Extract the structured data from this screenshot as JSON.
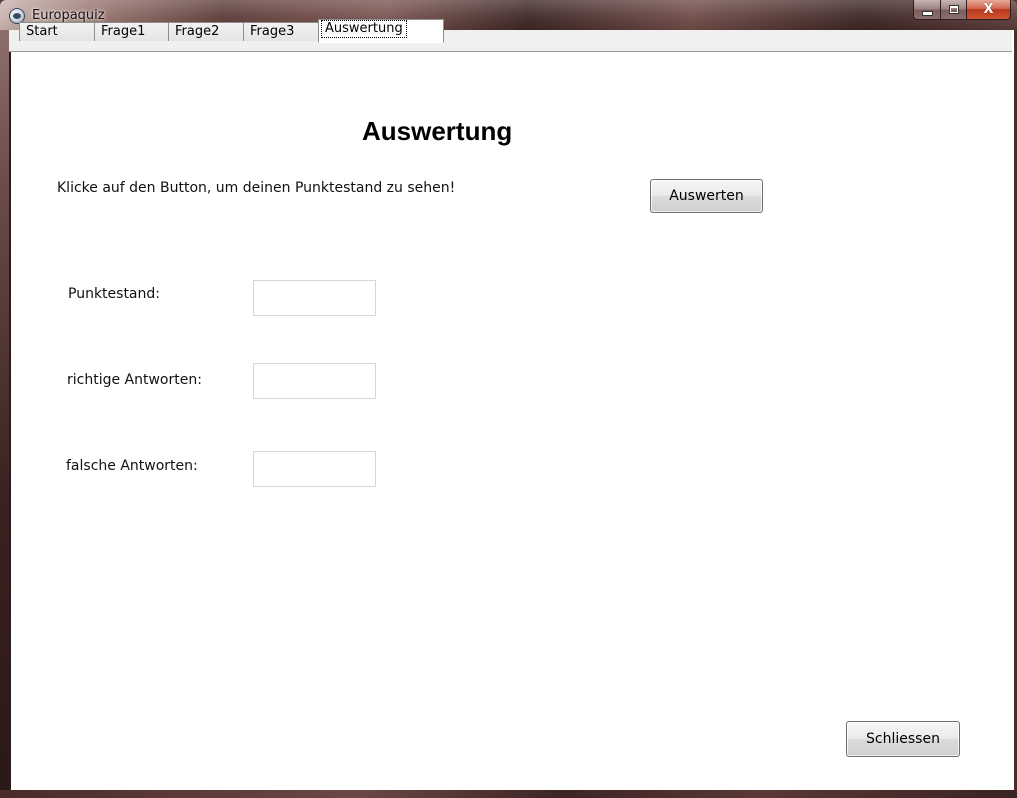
{
  "window": {
    "title": "Europaquiz",
    "icon": "app-globe-icon",
    "controls": {
      "minimize_icon": "minimize-icon",
      "maximize_icon": "maximize-icon",
      "close_label": "X"
    }
  },
  "tabs": [
    {
      "label": "Start",
      "active": false
    },
    {
      "label": "Frage1",
      "active": false
    },
    {
      "label": "Frage2",
      "active": false
    },
    {
      "label": "Frage3",
      "active": false
    },
    {
      "label": "Auswertung",
      "active": true
    }
  ],
  "main": {
    "heading": "Auswertung",
    "instruction": "Klicke auf den Button, um deinen Punktestand zu sehen!",
    "evaluate_button": "Auswerten",
    "fields": [
      {
        "label": "Punktestand:",
        "value": ""
      },
      {
        "label": "richtige Antworten:",
        "value": ""
      },
      {
        "label": "falsche Antworten:",
        "value": ""
      }
    ],
    "close_button": "Schliessen"
  },
  "colors": {
    "close_button": "#c4442a",
    "client_background": "#ffffff",
    "tab_strip": "#f0f0f0"
  }
}
